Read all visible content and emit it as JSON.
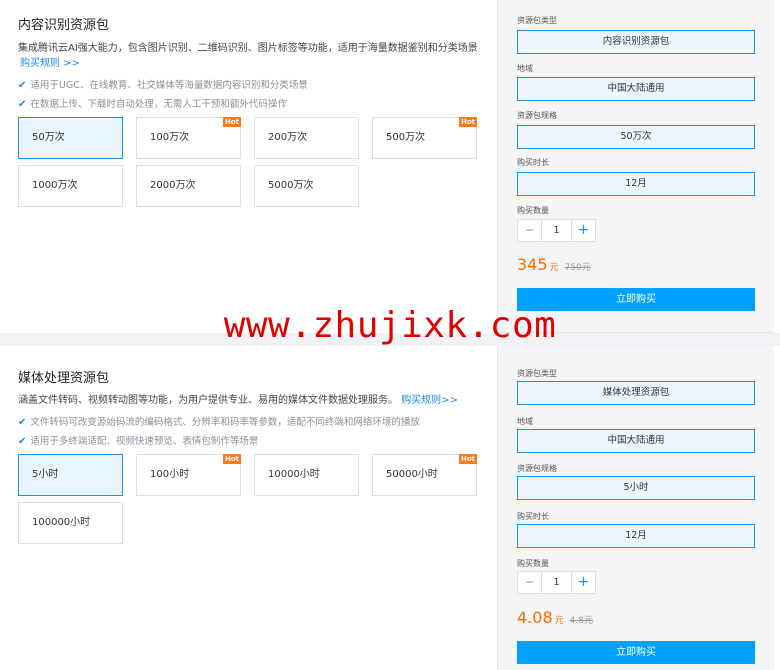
{
  "panel1": {
    "title": "内容识别资源包",
    "desc": "集成腾讯云AI强大能力，包含图片识别、二维码识别、图片标签等功能，适用于海量数据鉴别和分类场景",
    "rule_link": "购买规则 >>",
    "bullets": [
      "适用于UGC、在线教育、社交媒体等海量数据内容识别和分类场景",
      "在数据上传、下载时自动处理，无需人工干预和额外代码操作"
    ],
    "options": [
      {
        "label": "50万次",
        "selected": true,
        "hot": false
      },
      {
        "label": "100万次",
        "selected": false,
        "hot": true
      },
      {
        "label": "200万次",
        "selected": false,
        "hot": false
      },
      {
        "label": "500万次",
        "selected": false,
        "hot": true
      },
      {
        "label": "1000万次",
        "selected": false,
        "hot": false
      },
      {
        "label": "2000万次",
        "selected": false,
        "hot": false
      },
      {
        "label": "5000万次",
        "selected": false,
        "hot": false
      }
    ],
    "hot_badge": "Hot",
    "form": {
      "type_label": "资源包类型",
      "type_value": "内容识别资源包",
      "region_label": "地域",
      "region_value": "中国大陆通用",
      "spec_label": "资源包规格",
      "spec_value": "50万次",
      "duration_label": "购买时长",
      "duration_value": "12月",
      "qty_label": "购买数量",
      "qty": "1",
      "minus": "−",
      "plus": "+",
      "price": "345",
      "currency": "元",
      "old_price": "750元",
      "buy_label": "立即购买"
    }
  },
  "panel2": {
    "title": "媒体处理资源包",
    "desc": "涵盖文件转码、视频转动图等功能，为用户提供专业、易用的媒体文件数据处理服务。",
    "rule_link": "购买规则>>",
    "bullets": [
      "文件转码可改变源始码流的编码格式、分辨率和码率等参数，适配不同终端和网络环境的播放",
      "适用于多终端适配、视频快速预览、表情包制作等场景"
    ],
    "options": [
      {
        "label": "5小时",
        "selected": true,
        "hot": false
      },
      {
        "label": "100小时",
        "selected": false,
        "hot": true
      },
      {
        "label": "10000小时",
        "selected": false,
        "hot": false
      },
      {
        "label": "50000小时",
        "selected": false,
        "hot": true
      },
      {
        "label": "100000小时",
        "selected": false,
        "hot": false
      }
    ],
    "hot_badge": "Hot",
    "form": {
      "type_label": "资源包类型",
      "type_value": "媒体处理资源包",
      "region_label": "地域",
      "region_value": "中国大陆通用",
      "spec_label": "资源包规格",
      "spec_value": "5小时",
      "duration_label": "购买时长",
      "duration_value": "12月",
      "qty_label": "购买数量",
      "qty": "1",
      "minus": "−",
      "plus": "+",
      "price": "4.08",
      "currency": "元",
      "old_price": "4.8元",
      "buy_label": "立即购买"
    }
  },
  "watermark": "www.zhujixk.com",
  "icons": {
    "check": "✔"
  },
  "colors": {
    "accent": "#1f8fe8",
    "price": "#ff6a00",
    "buy": "#00a0ff",
    "hot": "#ff7a1a",
    "watermark": "#e00000"
  }
}
